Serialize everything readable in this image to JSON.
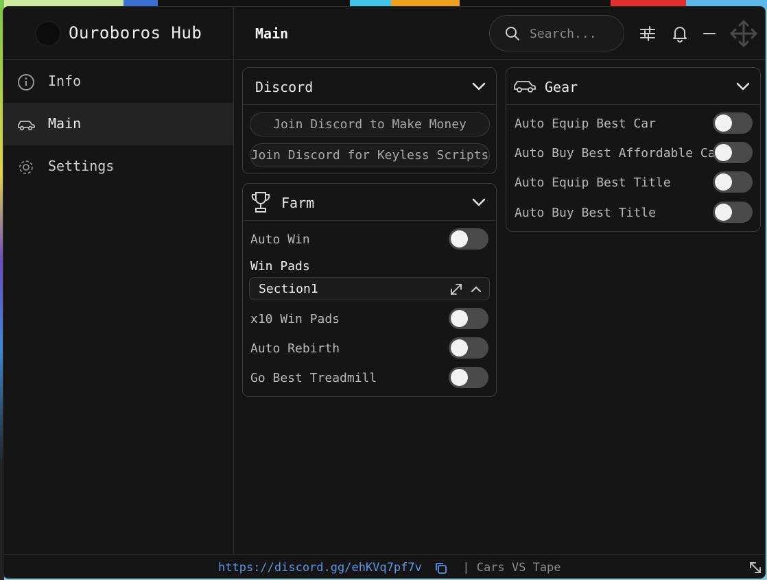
{
  "app": {
    "name": "Ouroboros Hub",
    "page_title": "Main"
  },
  "search": {
    "placeholder": "Search..."
  },
  "toolbar_icons": [
    "sliders-icon",
    "bell-icon",
    "minimize-icon",
    "move-icon"
  ],
  "sidebar": {
    "items": [
      {
        "label": "Info",
        "icon": "info-icon",
        "active": false
      },
      {
        "label": "Main",
        "icon": "car-icon",
        "active": true
      },
      {
        "label": "Settings",
        "icon": "gear-icon",
        "active": false
      }
    ]
  },
  "discord_card": {
    "title": "Discord",
    "buttons": [
      "Join Discord to Make Money",
      "Join Discord for Keyless Scripts"
    ]
  },
  "farm_card": {
    "title": "Farm",
    "icon": "trophy-icon",
    "toggles": [
      {
        "label": "Auto Win",
        "on": false
      }
    ],
    "win_pads_heading": "Win Pads",
    "win_pads_dropdown": "Section1",
    "toggles_after": [
      {
        "label": "x10 Win Pads",
        "on": false
      },
      {
        "label": "Auto Rebirth",
        "on": false
      },
      {
        "label": "Go Best Treadmill",
        "on": false
      }
    ]
  },
  "gear_card": {
    "title": "Gear",
    "icon": "car-icon",
    "toggles": [
      {
        "label": "Auto Equip Best Car",
        "on": false
      },
      {
        "label": "Auto Buy Best Affordable Car",
        "on": false
      },
      {
        "label": "Auto Equip Best Title",
        "on": false
      },
      {
        "label": "Auto Buy Best Title",
        "on": false
      }
    ]
  },
  "status": {
    "link": "https://discord.gg/ehKVq7pf7v",
    "separator_text": " | Cars VS Tape"
  },
  "colors": {
    "window_bg": "#151515",
    "active_nav": "#232323",
    "link": "#5e95e6",
    "toggle_off": "#4a4a4a"
  }
}
